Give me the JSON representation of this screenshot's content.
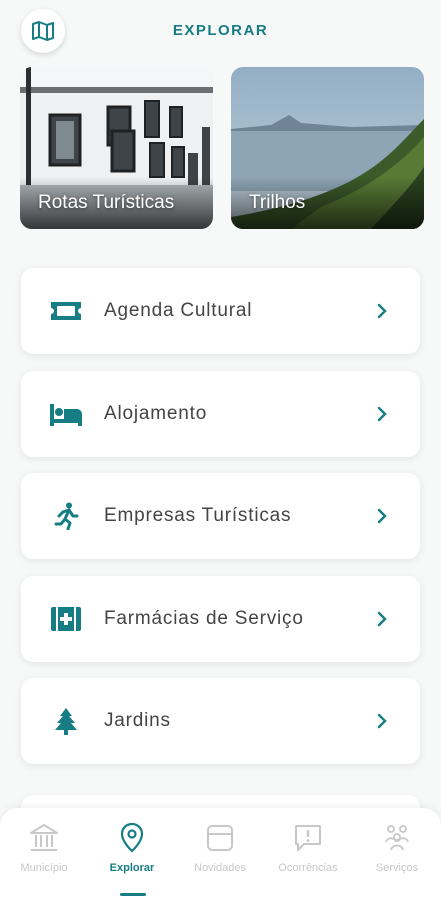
{
  "header": {
    "title": "EXPLORAR",
    "map_icon": "map-icon"
  },
  "tiles": [
    {
      "label": "Rotas Turísticas"
    },
    {
      "label": "Trilhos"
    }
  ],
  "menu": [
    {
      "label": "Agenda Cultural",
      "icon": "ticket-icon"
    },
    {
      "label": "Alojamento",
      "icon": "bed-icon"
    },
    {
      "label": "Empresas Turísticas",
      "icon": "running-person-icon"
    },
    {
      "label": "Farmácias de Serviço",
      "icon": "pharmacy-icon"
    },
    {
      "label": "Jardins",
      "icon": "tree-icon"
    }
  ],
  "nav": [
    {
      "label": "Município",
      "icon": "town-hall-icon"
    },
    {
      "label": "Explorar",
      "icon": "location-pin-icon",
      "active": true
    },
    {
      "label": "Novidades",
      "icon": "news-icon"
    },
    {
      "label": "Ocorrências",
      "icon": "alert-message-icon"
    },
    {
      "label": "Serviços",
      "icon": "services-icon"
    }
  ],
  "colors": {
    "accent": "#177d84",
    "inactive": "#c7c7c7",
    "background": "#f7f8f8"
  }
}
